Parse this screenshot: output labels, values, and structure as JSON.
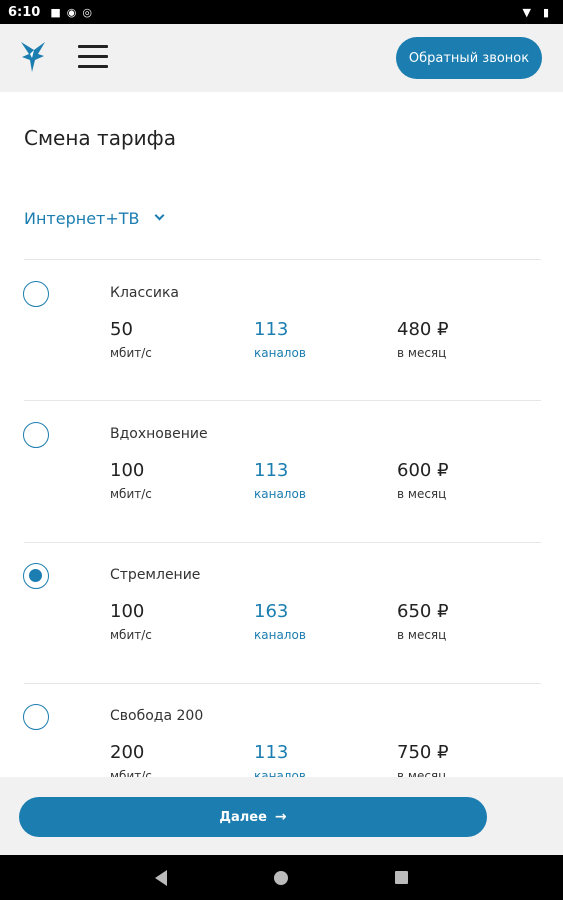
{
  "status_bar": {
    "time": "6:10"
  },
  "header": {
    "callback_label": "Обратный звонок"
  },
  "page": {
    "title": "Смена тарифа"
  },
  "filter": {
    "selected": "Интернет+ТВ"
  },
  "tariffs": [
    {
      "name": "Классика",
      "speed": "50",
      "speed_unit": "мбит/с",
      "channels": "113",
      "channels_unit": "каналов",
      "price": "480 ₽",
      "price_unit": "в месяц",
      "selected": false
    },
    {
      "name": "Вдохновение",
      "speed": "100",
      "speed_unit": "мбит/с",
      "channels": "113",
      "channels_unit": "каналов",
      "price": "600 ₽",
      "price_unit": "в месяц",
      "selected": false
    },
    {
      "name": "Стремление",
      "speed": "100",
      "speed_unit": "мбит/с",
      "channels": "163",
      "channels_unit": "каналов",
      "price": "650 ₽",
      "price_unit": "в месяц",
      "selected": true
    },
    {
      "name": "Свобода 200",
      "speed": "200",
      "speed_unit": "мбит/с",
      "channels": "113",
      "channels_unit": "каналов",
      "price": "750 ₽",
      "price_unit": "в месяц",
      "selected": false
    }
  ],
  "footer": {
    "next_label": "Далее",
    "next_arrow": "→"
  },
  "colors": {
    "accent": "#1b7db0",
    "header_bg": "#f1f1f1"
  }
}
